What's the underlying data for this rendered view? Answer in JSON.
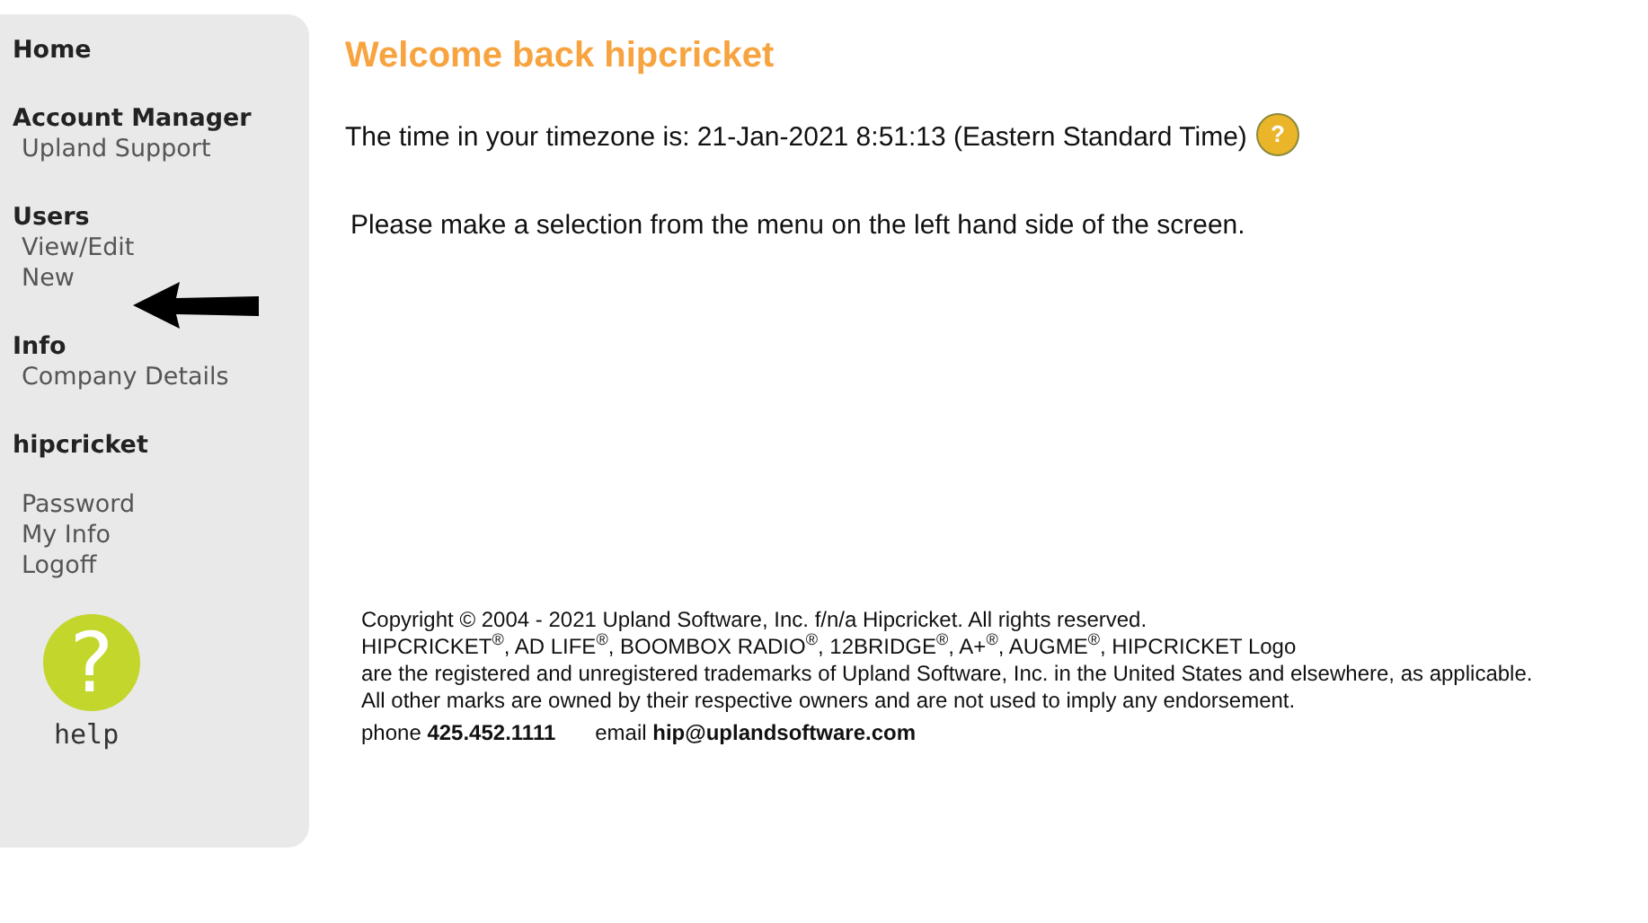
{
  "sidebar": {
    "sections": [
      {
        "heading": "Home"
      },
      {
        "heading": "Account Manager",
        "items": [
          "Upland Support"
        ]
      },
      {
        "heading": "Users",
        "items": [
          "View/Edit",
          "New"
        ]
      },
      {
        "heading": "Info",
        "items": [
          "Company Details"
        ]
      },
      {
        "heading": "hipcricket",
        "items": [
          "Password",
          "My Info",
          "Logoff"
        ]
      }
    ],
    "help": {
      "symbol": "?",
      "label": "help"
    }
  },
  "main": {
    "title": "Welcome back hipcricket",
    "timezone_text": "The time in your timezone is: 21-Jan-2021 8:51:13 (Eastern Standard Time)",
    "timezone_help": "?",
    "instruction": "Please make a selection from the menu on the left hand side of the screen.",
    "footer": {
      "lines": [
        "Copyright © 2004 - 2021 Upland Software, Inc. f/n/a Hipcricket. All rights reserved.",
        "HIPCRICKET$^{®}$, AD LIFE$^{®}$, BOOMBOX RADIO$^{®}$, 12BRIDGE$^{®}$, A+$^{®}$, AUGME$^{®}$, HIPCRICKET Logo",
        "are the registered and unregistered trademarks of Upland Software, Inc. in the United States and elsewhere, as applicable.",
        "All other marks are owned by their respective owners and are not used to imply any endorsement."
      ],
      "phone": "phone **425.452.1111**",
      "email": "email **hip@uplandsoftware.com**"
    }
  }
}
